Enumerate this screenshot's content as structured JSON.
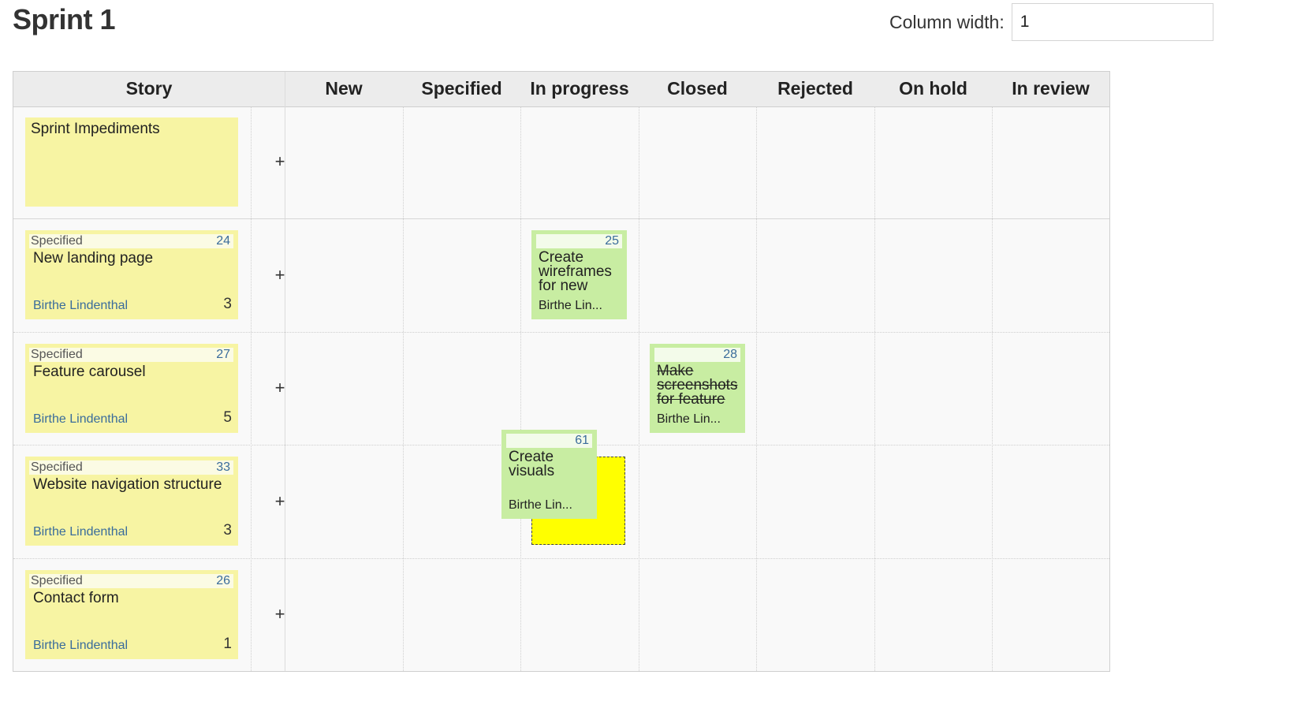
{
  "page": {
    "title": "Sprint 1",
    "column_width_label": "Column width:",
    "column_width_value": "1"
  },
  "board": {
    "columns": [
      "Story",
      "New",
      "Specified",
      "In progress",
      "Closed",
      "Rejected",
      "On hold",
      "In review"
    ],
    "add_label": "+",
    "impediments": {
      "title": "Sprint Impediments"
    },
    "stories": [
      {
        "status": "Specified",
        "id": "24",
        "title": "New landing page",
        "owner": "Birthe Lindenthal",
        "points": "3"
      },
      {
        "status": "Specified",
        "id": "27",
        "title": "Feature carousel",
        "owner": "Birthe Lindenthal",
        "points": "5"
      },
      {
        "status": "Specified",
        "id": "33",
        "title": "Website navigation structure",
        "owner": "Birthe Lindenthal",
        "points": "3"
      },
      {
        "status": "Specified",
        "id": "26",
        "title": "Contact form",
        "owner": "Birthe Lindenthal",
        "points": "1"
      }
    ],
    "tasks": [
      {
        "id": "25",
        "title": "Create wireframes for new landing page",
        "owner": "Birthe Lin...",
        "column": "In progress",
        "story_id": "24"
      },
      {
        "id": "28",
        "title": "Make screenshots for feature",
        "owner": "Birthe Lin...",
        "column": "Closed",
        "story_id": "27"
      },
      {
        "id": "61",
        "title": "Create visuals",
        "owner": "Birthe Lin...",
        "column": "In progress",
        "story_id": "33",
        "dragging": true
      }
    ]
  },
  "colors": {
    "story_card": "#f7f4a3",
    "task_card": "#c8eda2",
    "drop_placeholder": "#ffff00",
    "link_blue": "#3a6c9b"
  }
}
